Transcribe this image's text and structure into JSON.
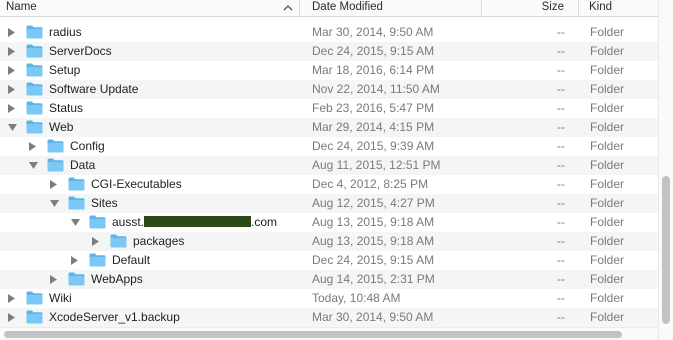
{
  "header": {
    "name": "Name",
    "date": "Date Modified",
    "size": "Size",
    "kind": "Kind"
  },
  "rows": [
    {
      "name": "radius",
      "date": "Mar 30, 2014, 9:50 AM",
      "size": "--",
      "kind": "Folder",
      "expanded": false,
      "level": 0
    },
    {
      "name": "ServerDocs",
      "date": "Dec 24, 2015, 9:15 AM",
      "size": "--",
      "kind": "Folder",
      "expanded": false,
      "level": 0
    },
    {
      "name": "Setup",
      "date": "Mar 18, 2016, 6:14 PM",
      "size": "--",
      "kind": "Folder",
      "expanded": false,
      "level": 0
    },
    {
      "name": "Software Update",
      "date": "Nov 22, 2014, 11:50 AM",
      "size": "--",
      "kind": "Folder",
      "expanded": false,
      "level": 0
    },
    {
      "name": "Status",
      "date": "Feb 23, 2016, 5:47 PM",
      "size": "--",
      "kind": "Folder",
      "expanded": false,
      "level": 0
    },
    {
      "name": "Web",
      "date": "Mar 29, 2014, 4:15 PM",
      "size": "--",
      "kind": "Folder",
      "expanded": true,
      "level": 0
    },
    {
      "name": "Config",
      "date": "Dec 24, 2015, 9:39 AM",
      "size": "--",
      "kind": "Folder",
      "expanded": false,
      "level": 1
    },
    {
      "name": "Data",
      "date": "Aug 11, 2015, 12:51 PM",
      "size": "--",
      "kind": "Folder",
      "expanded": true,
      "level": 1
    },
    {
      "name": "CGI-Executables",
      "date": "Dec 4, 2012, 8:25 PM",
      "size": "--",
      "kind": "Folder",
      "expanded": false,
      "level": 2
    },
    {
      "name": "Sites",
      "date": "Aug 12, 2015, 4:27 PM",
      "size": "--",
      "kind": "Folder",
      "expanded": true,
      "level": 2
    },
    {
      "name_prefix": "ausst.",
      "name_suffix": ".com",
      "date": "Aug 13, 2015, 9:18 AM",
      "size": "--",
      "kind": "Folder",
      "expanded": true,
      "level": 3,
      "redacted": true
    },
    {
      "name": "packages",
      "date": "Aug 13, 2015, 9:18 AM",
      "size": "--",
      "kind": "Folder",
      "expanded": false,
      "level": 4
    },
    {
      "name": "Default",
      "date": "Dec 24, 2015, 9:15 AM",
      "size": "--",
      "kind": "Folder",
      "expanded": false,
      "level": 3
    },
    {
      "name": "WebApps",
      "date": "Aug 14, 2015, 2:31 PM",
      "size": "--",
      "kind": "Folder",
      "expanded": false,
      "level": 2
    },
    {
      "name": "Wiki",
      "date": "Today, 10:48 AM",
      "size": "--",
      "kind": "Folder",
      "expanded": false,
      "level": 0
    },
    {
      "name": "XcodeServer_v1.backup",
      "date": "Mar 30, 2014, 9:50 AM",
      "size": "--",
      "kind": "Folder",
      "expanded": false,
      "level": 0
    }
  ],
  "colors": {
    "folder": "#7cc8f4",
    "folder_tab": "#5db4ea",
    "disclosure": "#7d7d7d",
    "alt_row": "#f4f5f5"
  }
}
